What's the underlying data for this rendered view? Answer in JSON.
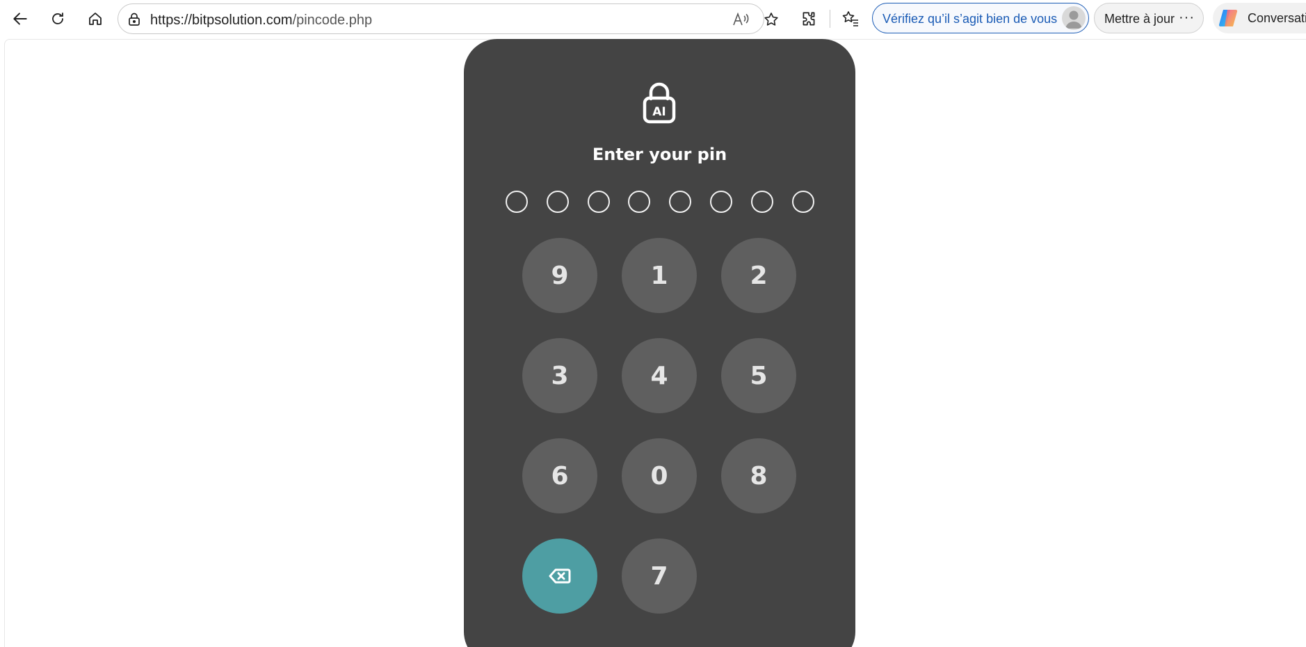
{
  "browser": {
    "url_domain": "https://bitpsolution.com",
    "url_path": "/pincode.php",
    "verify_label": "Vérifiez qu’il s’agit bien de vous",
    "update_label": "Mettre à jour",
    "more_label": "···",
    "copilot_label": "Conversati",
    "icons": [
      "back-icon",
      "refresh-icon",
      "home-icon",
      "lock-icon",
      "read-aloud-icon",
      "favorite-star-icon",
      "extensions-icon",
      "favorites-icon",
      "profile-avatar",
      "more-icon",
      "copilot-icon"
    ],
    "colors": {
      "accent": "#1a5bb5"
    }
  },
  "pin": {
    "icon": "lock-ai-icon",
    "icon_label": "AI",
    "title": "Enter your pin",
    "slots_filled": 0,
    "slots_total": 8,
    "keys": [
      {
        "label": "9"
      },
      {
        "label": "1"
      },
      {
        "label": "2"
      },
      {
        "label": "3"
      },
      {
        "label": "4"
      },
      {
        "label": "5"
      },
      {
        "label": "6"
      },
      {
        "label": "0"
      },
      {
        "label": "8"
      },
      {
        "label": "",
        "icon": "backspace-icon"
      },
      {
        "label": "7"
      }
    ],
    "colors": {
      "card": "#444444",
      "key": "#5f5f5f",
      "delete_key": "#4e9ea3",
      "text": "#ffffff"
    }
  }
}
